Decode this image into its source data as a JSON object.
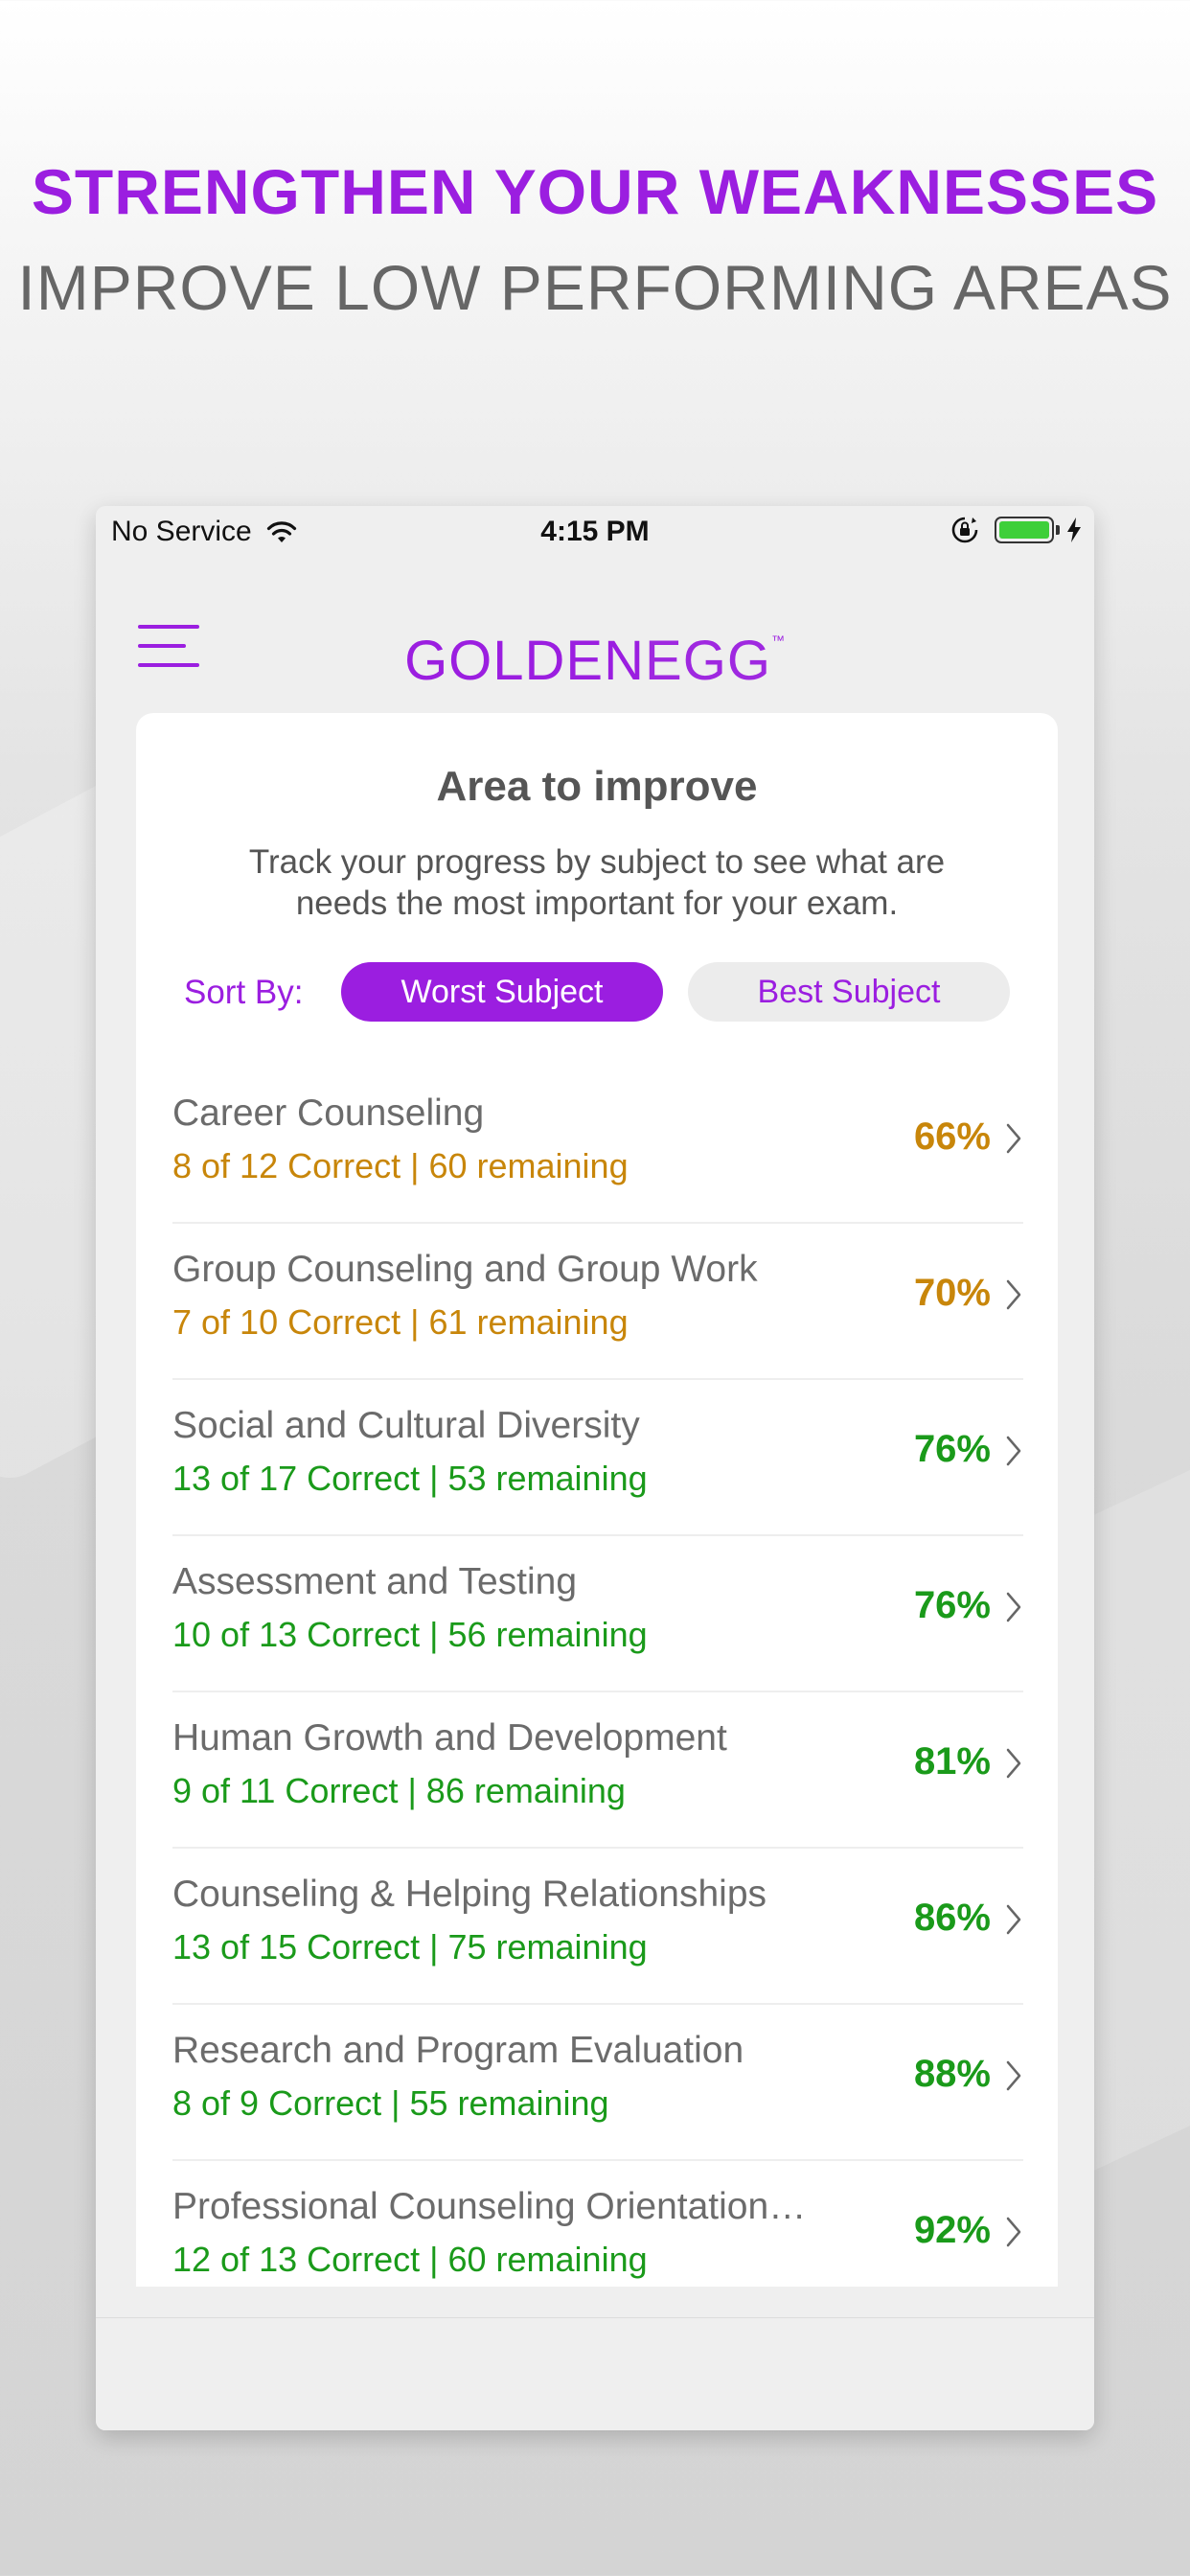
{
  "promo": {
    "headline": "STRENGTHEN YOUR WEAKNESSES",
    "subheadline": "IMPROVE LOW PERFORMING AREAS"
  },
  "status_bar": {
    "carrier": "No Service",
    "time": "4:15 PM",
    "battery_level": 1.0
  },
  "nav": {
    "logo_main": "GOLDEN",
    "logo_sub": "EGG",
    "logo_tm": "™"
  },
  "card": {
    "title": "Area to improve",
    "description": "Track your progress by subject to see what are needs the most important for your exam.",
    "sort_label": "Sort By:",
    "sort_options": [
      "Worst Subject",
      "Best Subject"
    ],
    "sort_selected": "Worst Subject"
  },
  "colors": {
    "brand_purple": "#9b1ee0",
    "warning_gold": "#c8860a",
    "success_green": "#1a9a1a"
  },
  "subjects": [
    {
      "name": "Career Counseling",
      "stats": "8 of 12  Correct | 60 remaining",
      "percent": "66%",
      "level": "warning"
    },
    {
      "name": "Group Counseling and Group Work",
      "stats": "7 of 10  Correct | 61 remaining",
      "percent": "70%",
      "level": "warning"
    },
    {
      "name": "Social and Cultural Diversity",
      "stats": "13 of 17  Correct | 53 remaining",
      "percent": "76%",
      "level": "success"
    },
    {
      "name": "Assessment and Testing",
      "stats": "10 of 13  Correct | 56 remaining",
      "percent": "76%",
      "level": "success"
    },
    {
      "name": "Human Growth and Development",
      "stats": "9 of 11  Correct | 86 remaining",
      "percent": "81%",
      "level": "success"
    },
    {
      "name": "Counseling & Helping Relationships",
      "stats": "13 of 15  Correct | 75 remaining",
      "percent": "86%",
      "level": "success"
    },
    {
      "name": "Research and Program Evaluation",
      "stats": "8 of 9  Correct | 55 remaining",
      "percent": "88%",
      "level": "success"
    },
    {
      "name": "Professional Counseling Orientation…",
      "stats": "12 of 13  Correct | 60 remaining",
      "percent": "92%",
      "level": "success"
    }
  ]
}
